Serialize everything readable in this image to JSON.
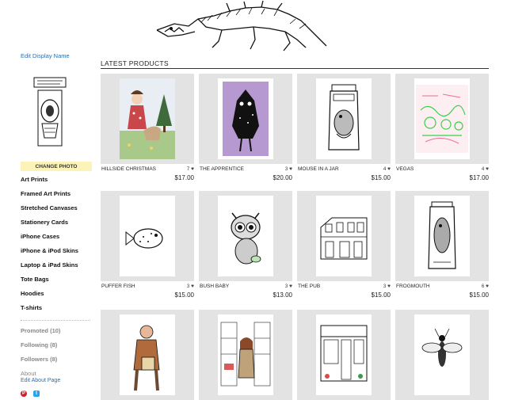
{
  "sidebar": {
    "edit_display_name": "Edit Display Name",
    "change_photo": "CHANGE PHOTO",
    "nav": [
      "Art Prints",
      "Framed Art Prints",
      "Stretched Canvases",
      "Stationery Cards",
      "iPhone Cases",
      "iPhone & iPod Skins",
      "Laptop & iPad Skins",
      "Tote Bags",
      "Hoodies",
      "T-shirts"
    ],
    "promoted": "Promoted (10)",
    "following": "Following (8)",
    "followers": "Followers (8)",
    "about": "About",
    "edit_about": "Edit About Page"
  },
  "main": {
    "heading": "LATEST PRODUCTS",
    "products": [
      {
        "name": "HILLSIDE CHRISTMAS",
        "likes": "7",
        "price": "$17.00",
        "icon": "hillside-christmas"
      },
      {
        "name": "THE APPRENTICE",
        "likes": "3",
        "price": "$20.00",
        "icon": "the-apprentice"
      },
      {
        "name": "MOUSE IN A JAR",
        "likes": "4",
        "price": "$15.00",
        "icon": "mouse-in-a-jar"
      },
      {
        "name": "VEGAS",
        "likes": "4",
        "price": "$17.00",
        "icon": "vegas"
      },
      {
        "name": "PUFFER FISH",
        "likes": "3",
        "price": "$15.00",
        "icon": "puffer-fish"
      },
      {
        "name": "BUSH BABY",
        "likes": "3",
        "price": "$13.00",
        "icon": "bush-baby"
      },
      {
        "name": "THE PUB",
        "likes": "3",
        "price": "$15.00",
        "icon": "the-pub"
      },
      {
        "name": "FROGMOUTH",
        "likes": "6",
        "price": "$15.00",
        "icon": "frogmouth"
      },
      {
        "name": "",
        "likes": "",
        "price": "",
        "icon": "man-with-bag"
      },
      {
        "name": "",
        "likes": "",
        "price": "",
        "icon": "shop-worker"
      },
      {
        "name": "",
        "likes": "",
        "price": "",
        "icon": "shop-front"
      },
      {
        "name": "",
        "likes": "",
        "price": "",
        "icon": "insect"
      }
    ]
  },
  "colors": {
    "link": "#2a6fb0",
    "change_photo_bg": "#fbf3b8",
    "thumb_bg": "#e3e3e3",
    "muted": "#888888"
  }
}
